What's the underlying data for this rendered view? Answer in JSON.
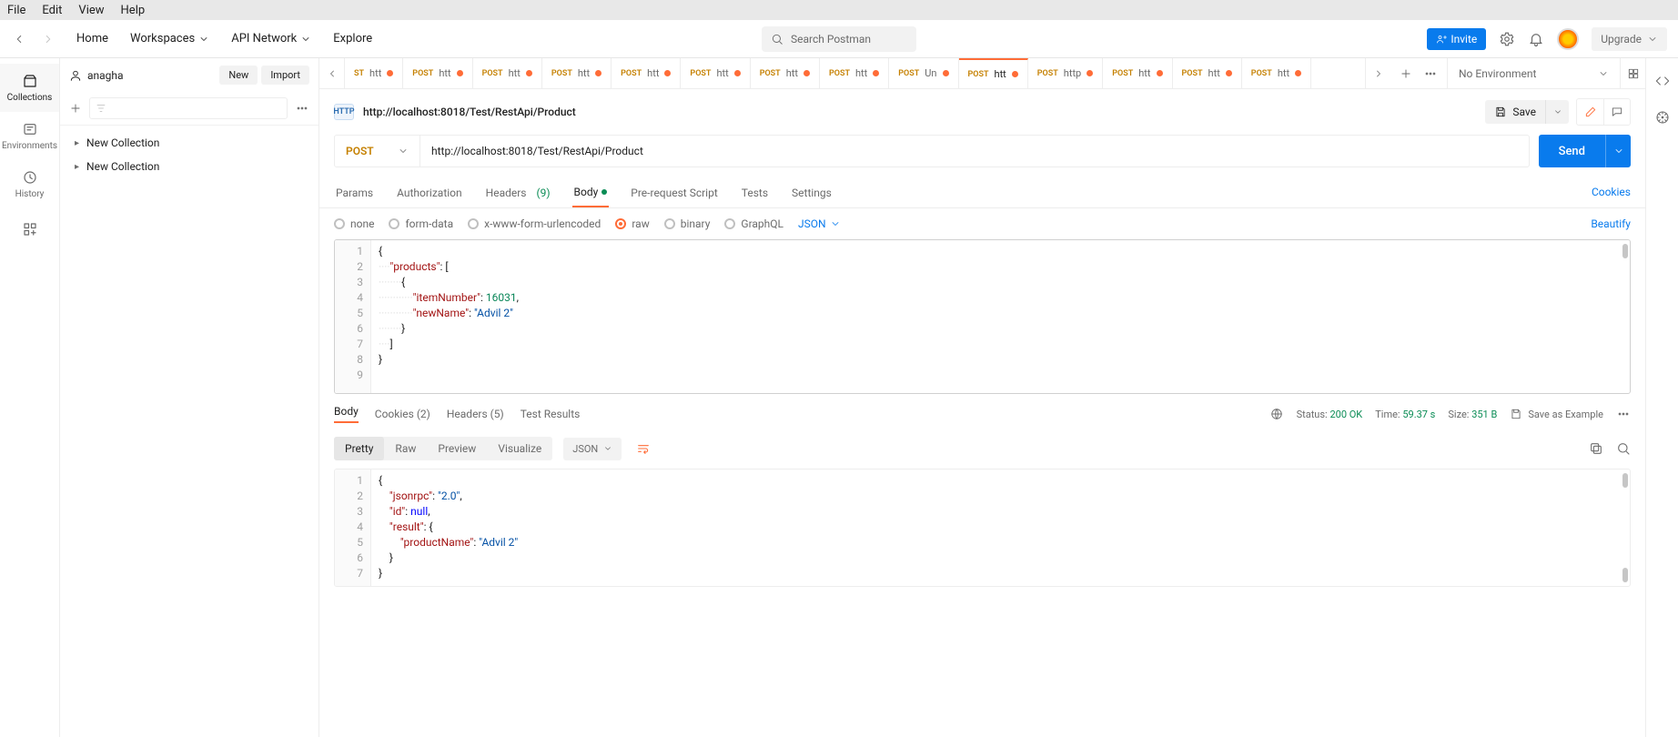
{
  "os_menu": [
    "File",
    "Edit",
    "View",
    "Help"
  ],
  "header": {
    "links": {
      "home": "Home",
      "workspaces": "Workspaces",
      "api_network": "API Network",
      "explore": "Explore"
    },
    "search_placeholder": "Search Postman",
    "invite": "Invite",
    "upgrade": "Upgrade"
  },
  "workspace_user": "anagha",
  "sidebar_buttons": {
    "new": "New",
    "import": "Import"
  },
  "ws_nav": {
    "collections": "Collections",
    "environments": "Environments",
    "history": "History"
  },
  "collections": [
    "New Collection",
    "New Collection"
  ],
  "tabs": [
    {
      "method": "ST",
      "label": "htt",
      "dirty": true
    },
    {
      "method": "POST",
      "label": "htt",
      "dirty": true
    },
    {
      "method": "POST",
      "label": "htt",
      "dirty": true
    },
    {
      "method": "POST",
      "label": "htt",
      "dirty": true
    },
    {
      "method": "POST",
      "label": "htt",
      "dirty": true
    },
    {
      "method": "POST",
      "label": "htt",
      "dirty": true
    },
    {
      "method": "POST",
      "label": "htt",
      "dirty": true
    },
    {
      "method": "POST",
      "label": "htt",
      "dirty": true
    },
    {
      "method": "POST",
      "label": "Un",
      "dirty": true
    },
    {
      "method": "POST",
      "label": "htt",
      "dirty": true,
      "active": true
    },
    {
      "method": "POST",
      "label": "http",
      "dirty": true
    },
    {
      "method": "POST",
      "label": "htt",
      "dirty": true
    },
    {
      "method": "POST",
      "label": "htt",
      "dirty": true
    },
    {
      "method": "POST",
      "label": "htt",
      "dirty": true
    }
  ],
  "env_label": "No Environment",
  "request": {
    "badge": "HTTP",
    "title": "http://localhost:8018/Test/RestApi/Product",
    "save": "Save",
    "method": "POST",
    "url": "http://localhost:8018/Test/RestApi/Product",
    "send": "Send",
    "tabs": {
      "params": "Params",
      "auth": "Authorization",
      "headers": "Headers",
      "headers_count": "(9)",
      "body": "Body",
      "prereq": "Pre-request Script",
      "tests": "Tests",
      "settings": "Settings",
      "cookies": "Cookies"
    },
    "body_opts": {
      "none": "none",
      "form": "form-data",
      "url": "x-www-form-urlencoded",
      "raw": "raw",
      "binary": "binary",
      "graphql": "GraphQL",
      "json": "JSON",
      "beautify": "Beautify"
    },
    "body_json": {
      "products": [
        {
          "itemNumber": 16031,
          "newName": "Advil 2"
        }
      ]
    }
  },
  "response": {
    "tabs": {
      "body": "Body",
      "cookies": "Cookies",
      "cookies_n": "(2)",
      "headers": "Headers",
      "headers_n": "(5)",
      "tests": "Test Results"
    },
    "status_label": "Status:",
    "status": "200 OK",
    "time_label": "Time:",
    "time": "59.37 s",
    "size_label": "Size:",
    "size": "351 B",
    "save_example": "Save as Example",
    "view": {
      "pretty": "Pretty",
      "raw": "Raw",
      "preview": "Preview",
      "visualize": "Visualize",
      "fmt": "JSON"
    },
    "body_json": {
      "jsonrpc": "2.0",
      "id": null,
      "result": {
        "productName": "Advil 2"
      }
    }
  }
}
